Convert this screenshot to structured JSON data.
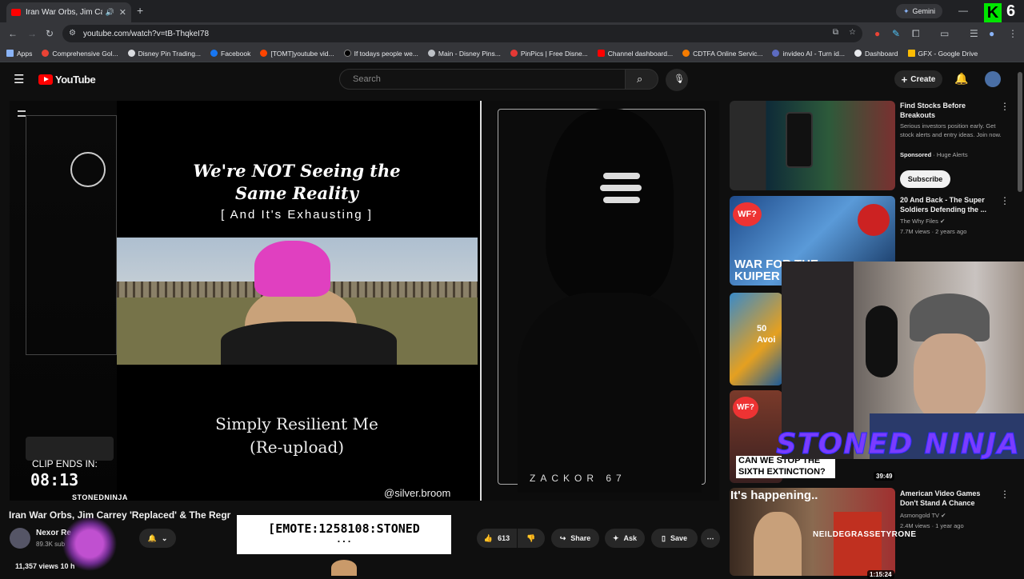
{
  "browser": {
    "tab_title": "Iran War Orbs, Jim Carrey 'R",
    "new_tab": "+",
    "url": "youtube.com/watch?v=tB-ThqkeI78",
    "gemini_label": "Gemini",
    "bookmarks": [
      {
        "label": "Apps",
        "color": "#8ab4f8"
      },
      {
        "label": "Comprehensive Gol...",
        "color": "#ea4335"
      },
      {
        "label": "Disney Pin Trading...",
        "color": "#dadce0"
      },
      {
        "label": "Facebook",
        "color": "#1877f2"
      },
      {
        "label": "[TOMT]youtube vid...",
        "color": "#ff4500"
      },
      {
        "label": "If todays people we...",
        "color": "#000000"
      },
      {
        "label": "Main - Disney Pins...",
        "color": "#bdc1c6"
      },
      {
        "label": "PinPics | Free Disne...",
        "color": "#e53935"
      },
      {
        "label": "Channel dashboard...",
        "color": "#ff0000"
      },
      {
        "label": "CDTFA Online Servic...",
        "color": "#f57c00"
      },
      {
        "label": "invideo AI - Turn id...",
        "color": "#5c6bc0"
      },
      {
        "label": "Dashboard",
        "color": "#e8eaed"
      },
      {
        "label": "GFX - Google Drive",
        "color": "#fbbc04"
      }
    ]
  },
  "youtube": {
    "logo_text": "YouTube",
    "search_placeholder": "Search",
    "create_label": "Create"
  },
  "player": {
    "title_line1": "We're NOT Seeing the",
    "title_line2": "Same Reality",
    "title_sub": "[ And It's Exhausting ]",
    "credit_line1": "Simply Resilient Me",
    "credit_line2": "(Re-upload)",
    "handle": "@silver.broom",
    "clip_label": "CLIP ENDS IN:",
    "clip_time": "08:13",
    "stoned_tag": "STONEDNINJA",
    "ninja_caption": "ZACKOR 67"
  },
  "video": {
    "title": "Iran War Orbs, Jim Carrey 'Replaced' & The Regr",
    "channel_name": "Nexor Re",
    "subscribers": "89.3K sub",
    "views": "11,357 views 10 h",
    "likes": "613",
    "share_label": "Share",
    "ask_label": "Ask",
    "save_label": "Save",
    "emote_text": "[EMOTE:1258108:STONED",
    "emote_dots": "..."
  },
  "sidebar": {
    "ad": {
      "title": "Find Stocks Before Breakouts",
      "desc": "Serious investors position early. Get stock alerts and entry ideas. Join now.",
      "sponsored": "Sponsored",
      "advertiser": "Huge Alerts",
      "subscribe_label": "Subscribe"
    },
    "items": [
      {
        "title": "20 And Back - The Super Soldiers Defending the ...",
        "channel": "The Why Files",
        "meta": "7.7M views · 2 years ago",
        "thumb_text": "WAR FOR THE KUIPER",
        "badge": "WF?"
      },
      {
        "title": "",
        "channel": "",
        "meta": "",
        "thumb_text": "50 Avoi",
        "badge": ""
      },
      {
        "title": "",
        "channel": "",
        "meta": "",
        "thumb_text": "CAN WE STOP THE SIXTH EXTINCTION?",
        "badge": "WF?",
        "duration": "39:49"
      },
      {
        "title": "American Video Games Don't Stand A Chance",
        "channel": "Asmongold TV",
        "meta": "2.4M views · 1 year ago",
        "thumb_text": "It's happening..",
        "badge": "",
        "duration": "1:15:24"
      }
    ]
  },
  "overlay": {
    "stoned_ninja": "STONED NINJA",
    "neil": "NEILDEGRASSETYRONE",
    "top_right_logo": "6"
  }
}
